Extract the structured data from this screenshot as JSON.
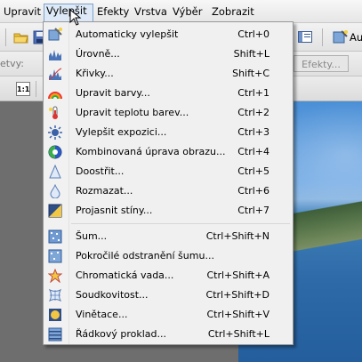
{
  "menubar": {
    "items": [
      {
        "label": "Upravit"
      },
      {
        "label": "Vylepšit"
      },
      {
        "label": "Efekty"
      },
      {
        "label": "Vrstva"
      },
      {
        "label": "Výběr"
      },
      {
        "label": "Zobrazit"
      }
    ]
  },
  "toolbar": {
    "left_label": "etvy:",
    "effects_label": "Efekty...",
    "right_label": "Au",
    "zoom_label": "1:1"
  },
  "menu": {
    "items": [
      {
        "label": "Automaticky vylepšit",
        "shortcut": "Ctrl+0",
        "icon": "auto-enhance-icon"
      },
      {
        "label": "Úrovně...",
        "shortcut": "Shift+L",
        "icon": "levels-icon"
      },
      {
        "label": "Křivky...",
        "shortcut": "Shift+C",
        "icon": "curves-icon"
      },
      {
        "label": "Upravit barvy...",
        "shortcut": "Ctrl+1",
        "icon": "rainbow-icon"
      },
      {
        "label": "Upravit teplotu barev...",
        "shortcut": "Ctrl+2",
        "icon": "thermometer-icon"
      },
      {
        "label": "Vylepšit expozici...",
        "shortcut": "Ctrl+3",
        "icon": "sun-icon"
      },
      {
        "label": "Kombinovaná úprava obrazu...",
        "shortcut": "Ctrl+4",
        "icon": "contrast-icon"
      },
      {
        "label": "Doostřit...",
        "shortcut": "Ctrl+5",
        "icon": "triangle-icon"
      },
      {
        "label": "Rozmazat...",
        "shortcut": "Ctrl+6",
        "icon": "drop-icon"
      },
      {
        "label": "Projasnit stíny...",
        "shortcut": "Ctrl+7",
        "icon": "shadows-icon"
      },
      {
        "label": "Šum...",
        "shortcut": "Ctrl+Shift+N",
        "icon": "noise-icon"
      },
      {
        "label": "Pokročilé odstranění šumu...",
        "shortcut": "",
        "icon": "advanced-noise-icon"
      },
      {
        "label": "Chromatická vada...",
        "shortcut": "Ctrl+Shift+A",
        "icon": "star-icon"
      },
      {
        "label": "Soudkovitost...",
        "shortcut": "Ctrl+Shift+D",
        "icon": "barrel-icon"
      },
      {
        "label": "Vinětace...",
        "shortcut": "Ctrl+Shift+V",
        "icon": "vignette-icon"
      },
      {
        "label": "Řádkový proklad...",
        "shortcut": "Ctrl+Shift+L",
        "icon": "interlace-icon"
      }
    ]
  }
}
